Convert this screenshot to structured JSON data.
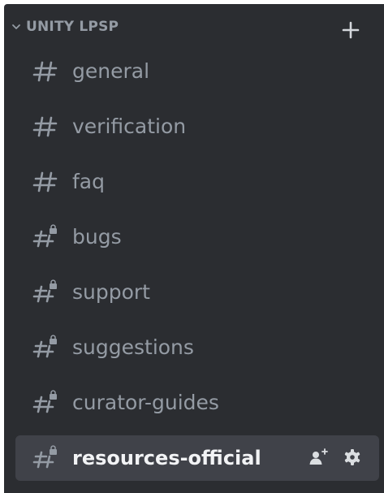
{
  "category": {
    "name": "UNITY LPSP",
    "chevron_icon": "chevron-down-icon",
    "add_icon": "plus-icon"
  },
  "channels": [
    {
      "name": "general",
      "icon": "text-channel-icon",
      "locked": false,
      "active": false
    },
    {
      "name": "verification",
      "icon": "text-channel-icon",
      "locked": false,
      "active": false
    },
    {
      "name": "faq",
      "icon": "text-channel-icon",
      "locked": false,
      "active": false
    },
    {
      "name": "bugs",
      "icon": "locked-text-channel-icon",
      "locked": true,
      "active": false
    },
    {
      "name": "support",
      "icon": "locked-text-channel-icon",
      "locked": true,
      "active": false
    },
    {
      "name": "suggestions",
      "icon": "locked-text-channel-icon",
      "locked": true,
      "active": false
    },
    {
      "name": "curator-guides",
      "icon": "locked-text-channel-icon",
      "locked": true,
      "active": false
    },
    {
      "name": "resources-official",
      "icon": "locked-text-channel-icon",
      "locked": true,
      "active": true,
      "actions": [
        "add-member-icon",
        "gear-icon"
      ]
    }
  ],
  "colors": {
    "background": "#2b2d31",
    "muted_text": "#949ba4",
    "active_text": "#f2f3f5",
    "active_row": "#404249",
    "icon_bright": "#dbdee1"
  }
}
